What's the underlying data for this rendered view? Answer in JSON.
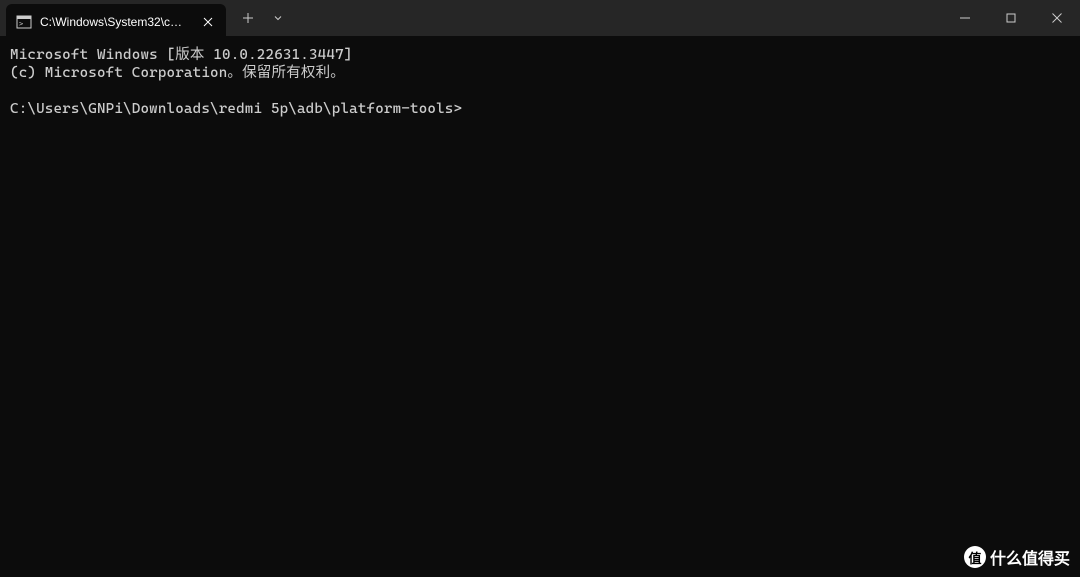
{
  "titlebar": {
    "tab": {
      "title": "C:\\Windows\\System32\\cmd.e"
    }
  },
  "terminal": {
    "line1": "Microsoft Windows [版本 10.0.22631.3447]",
    "line2": "(c) Microsoft Corporation。保留所有权利。",
    "blank": "",
    "prompt": "C:\\Users\\GNPi\\Downloads\\redmi 5p\\adb\\platform-tools>"
  },
  "watermark": {
    "badge": "值",
    "text": "什么值得买"
  }
}
